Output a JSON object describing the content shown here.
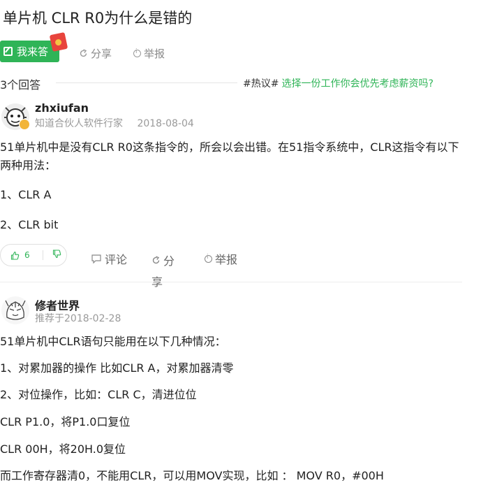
{
  "question": {
    "title": "单片机 CLR R0为什么是错的",
    "answer_button": "我来答",
    "share": "分享",
    "report": "举报"
  },
  "answers_header": {
    "count": "3个回答",
    "hot_tag": "#热议#",
    "hot_question": "选择一份工作你会优先考虑薪资吗?"
  },
  "answer1": {
    "user": "zhxiufan",
    "role": "知道合伙人软件行家",
    "date": "2018-08-04",
    "text1": "51单片机中是没有CLR R0这条指令的，所会以会出错。在51指令系统中，CLR这指令有以下两种用法：",
    "text2": "1、CLR A",
    "text3": "2、CLR bit",
    "likes": "6",
    "comment": "评论",
    "share_a": "分",
    "share_b": "享",
    "report": "举报"
  },
  "answer2": {
    "user": "修者世界",
    "meta": "推荐于2018-02-28",
    "lines": [
      "51单片机中CLR语句只能用在以下几种情况：",
      "1、对累加器的操作 比如CLR A，对累加器清零",
      "2、对位操作，比如：CLR C，清进位位",
      "CLR P1.0，将P1.0口复位",
      "CLR 00H，将20H.0复位",
      "而工作寄存器清0，不能用CLR，可以用MOV实现，比如 ： MOV R0，#00H"
    ]
  },
  "icons": [
    "edit-icon",
    "share-icon",
    "report-icon",
    "thumb-up-icon",
    "thumb-down-icon",
    "comment-icon",
    "verified-badge-icon"
  ],
  "colors": {
    "accent": "#2fb457",
    "muted": "#9a9a9a",
    "badge": "#f2b53a",
    "red_packet": "#e8443c"
  }
}
